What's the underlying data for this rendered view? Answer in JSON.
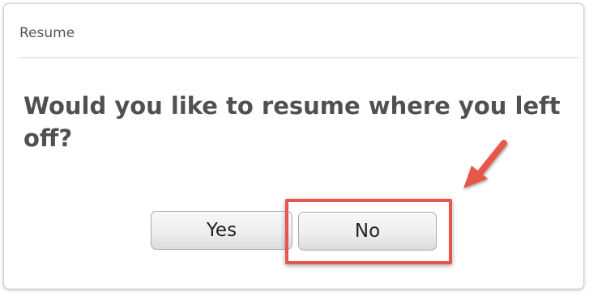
{
  "dialog": {
    "title": "Resume",
    "question": "Would you like to resume where you left off?",
    "buttons": {
      "yes_label": "Yes",
      "no_label": "No"
    }
  },
  "annotation": {
    "highlight_color": "#e8554a",
    "arrow_icon": "pointing-arrow-icon"
  }
}
